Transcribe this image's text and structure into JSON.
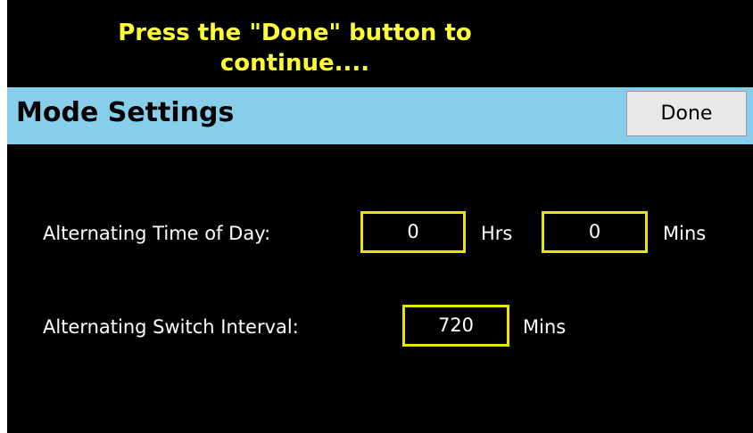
{
  "banner": {
    "line1": "Press the \"Done\" button to",
    "line2": "continue...."
  },
  "header": {
    "title": "Mode Settings",
    "done_label": "Done"
  },
  "settings": {
    "time_of_day": {
      "label": "Alternating Time of Day:",
      "hours_value": "0",
      "hours_unit": "Hrs",
      "minutes_value": "0",
      "minutes_unit": "Mins"
    },
    "switch_interval": {
      "label": "Alternating Switch Interval:",
      "value": "720",
      "unit": "Mins"
    }
  },
  "colors": {
    "background": "#000000",
    "banner_text": "#ffff33",
    "titlebar": "#87ceeb",
    "field_border": "#e6e600",
    "button": "#e8e8e8"
  }
}
